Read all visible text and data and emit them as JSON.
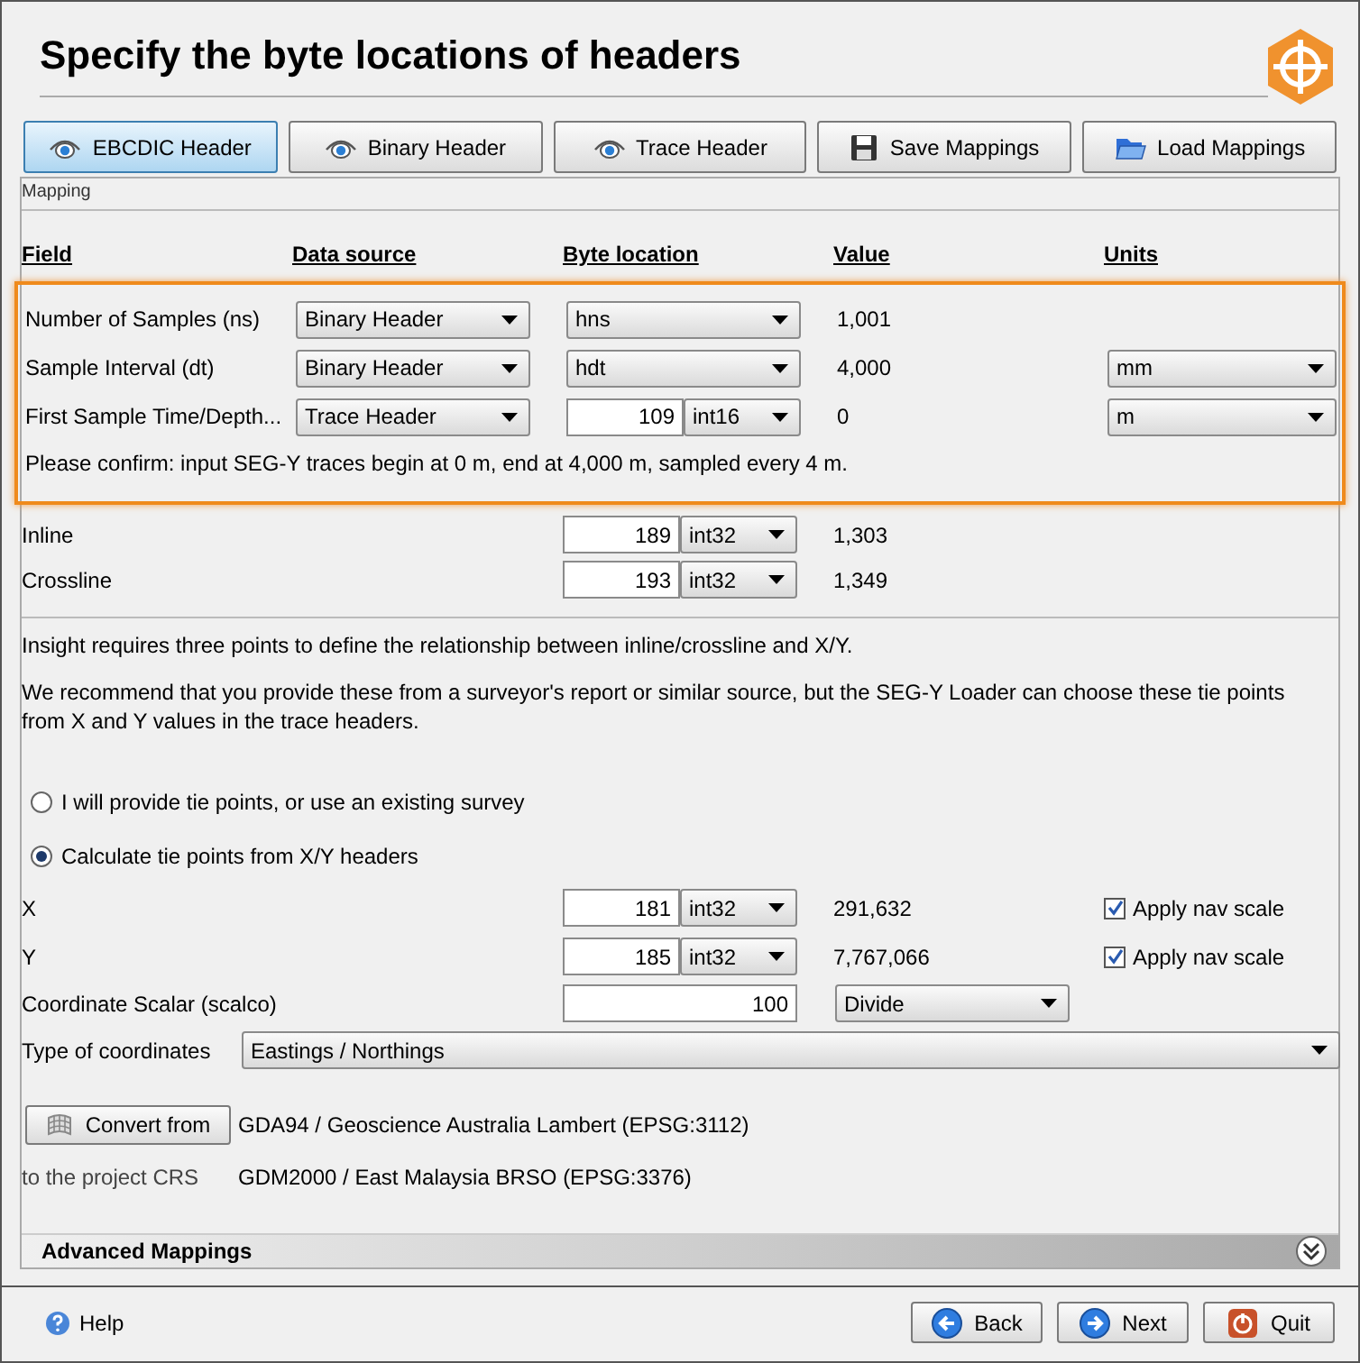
{
  "title": "Specify the byte locations of headers",
  "toolbar": [
    {
      "label": "EBCDIC Header",
      "selected": true
    },
    {
      "label": "Binary Header",
      "selected": false
    },
    {
      "label": "Trace Header",
      "selected": false
    },
    {
      "label": "Save Mappings",
      "selected": false
    },
    {
      "label": "Load Mappings",
      "selected": false
    }
  ],
  "mapping": {
    "title": "Mapping",
    "columns": [
      "Field",
      "Data source",
      "Byte location",
      "Value",
      "Units"
    ],
    "highlight": {
      "rows": [
        {
          "field": "Number of Samples (ns)",
          "source": "Binary Header",
          "byte": {
            "kind": "select",
            "value": "hns"
          },
          "value": "1,001"
        },
        {
          "field": "Sample Interval (dt)",
          "source": "Binary Header",
          "byte": {
            "kind": "select",
            "value": "hdt"
          },
          "value": "4,000",
          "units": "mm"
        },
        {
          "field": "First Sample Time/Depth...",
          "source": "Trace Header",
          "byte": {
            "kind": "offset",
            "value": "109",
            "type": "int16"
          },
          "value": "0",
          "units": "m"
        }
      ],
      "note": "Please confirm: input SEG-Y traces begin at 0 m, end at 4,000 m, sampled every 4 m."
    },
    "rows": [
      {
        "field": "Inline",
        "byte": {
          "kind": "offset",
          "value": "189",
          "type": "int32"
        },
        "value": "1,303"
      },
      {
        "field": "Crossline",
        "byte": {
          "kind": "offset",
          "value": "193",
          "type": "int32"
        },
        "value": "1,349"
      }
    ],
    "paragraphs": [
      "Insight requires three points to define the relationship between inline/crossline and X/Y.",
      "We recommend that you provide these from a surveyor's report or similar source, but the SEG-Y Loader can choose these tie points from X and Y values in the trace headers."
    ],
    "tie_options": [
      {
        "label": "I will provide tie points, or use an existing survey",
        "selected": false
      },
      {
        "label": "Calculate tie points from X/Y headers",
        "selected": true
      }
    ],
    "xy_rows": [
      {
        "field": "X",
        "byte": {
          "kind": "offset",
          "value": "181",
          "type": "int32"
        },
        "value": "291,632",
        "nav_scale": {
          "label": "Apply nav scale",
          "checked": true
        }
      },
      {
        "field": "Y",
        "byte": {
          "kind": "offset",
          "value": "185",
          "type": "int32"
        },
        "value": "7,767,066",
        "nav_scale": {
          "label": "Apply nav scale",
          "checked": true
        }
      }
    ],
    "scalar": {
      "label": "Coordinate Scalar (scalco)",
      "value": "100",
      "mode": "Divide"
    },
    "coordinates": {
      "label": "Type of coordinates",
      "value": "Eastings / Northings"
    },
    "convert": {
      "button": "Convert from",
      "from": "GDA94 / Geoscience Australia Lambert (EPSG:3112)",
      "to_label": "to the project CRS",
      "to": "GDM2000 / East Malaysia BRSO (EPSG:3376)"
    },
    "advanced": {
      "label": "Advanced Mappings",
      "expanded": false
    }
  },
  "footer": {
    "help": "Help",
    "buttons": [
      "Back",
      "Next",
      "Quit"
    ]
  }
}
